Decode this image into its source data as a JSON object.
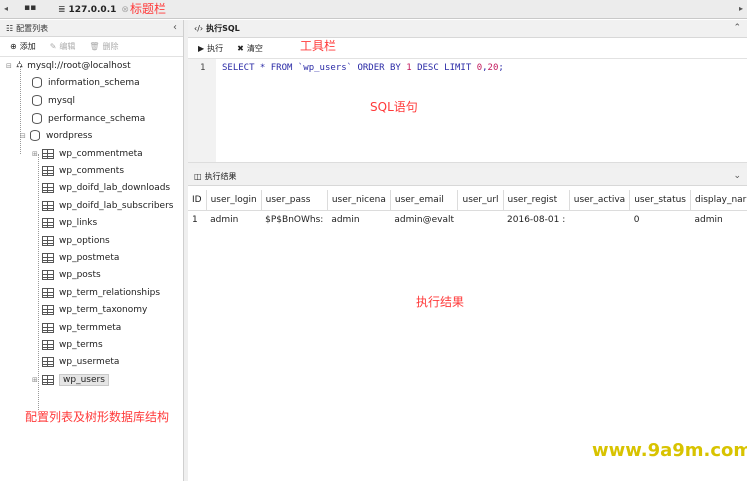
{
  "tabbar": {
    "host": "127.0.0.1",
    "annotation": "标题栏"
  },
  "left": {
    "title": "配置列表",
    "actions": [
      {
        "label": "添加",
        "enabled": true
      },
      {
        "label": "编辑",
        "enabled": false
      },
      {
        "label": "删除",
        "enabled": false
      }
    ],
    "tree": {
      "connection": "mysql://root@localhost",
      "databases": [
        "information_schema",
        "mysql",
        "performance_schema",
        "wordpress"
      ],
      "tables": [
        "wp_commentmeta",
        "wp_comments",
        "wp_doifd_lab_downloads",
        "wp_doifd_lab_subscribers",
        "wp_links",
        "wp_options",
        "wp_postmeta",
        "wp_posts",
        "wp_term_relationships",
        "wp_term_taxonomy",
        "wp_termmeta",
        "wp_terms",
        "wp_usermeta",
        "wp_users"
      ],
      "selected": "wp_users"
    },
    "annotation": "配置列表及树形数据库结构"
  },
  "sql": {
    "title": "执行SQL",
    "toolbar": {
      "run": "执行",
      "clear": "清空"
    },
    "toolbar_annotation": "工具栏",
    "line_number": "1",
    "statement": {
      "before_num1": "SELECT * FROM `wp_users` ORDER BY ",
      "num1": "1",
      "mid": " DESC LIMIT ",
      "num2": "0",
      "comma": ",",
      "num3": "20",
      "end": ";"
    },
    "annotation": "SQL语句"
  },
  "result": {
    "title": "执行结果",
    "columns": [
      "ID",
      "user_login",
      "user_pass",
      "user_nicena",
      "user_email",
      "user_url",
      "user_regist",
      "user_activa",
      "user_status",
      "display_nar"
    ],
    "rows": [
      [
        "1",
        "admin",
        "$P$BnOWhs:",
        "admin",
        "admin@evalt",
        "",
        "2016-08-01 :",
        "",
        "0",
        "admin"
      ]
    ],
    "annotation": "执行结果"
  },
  "watermark": "www.9a9m.com"
}
